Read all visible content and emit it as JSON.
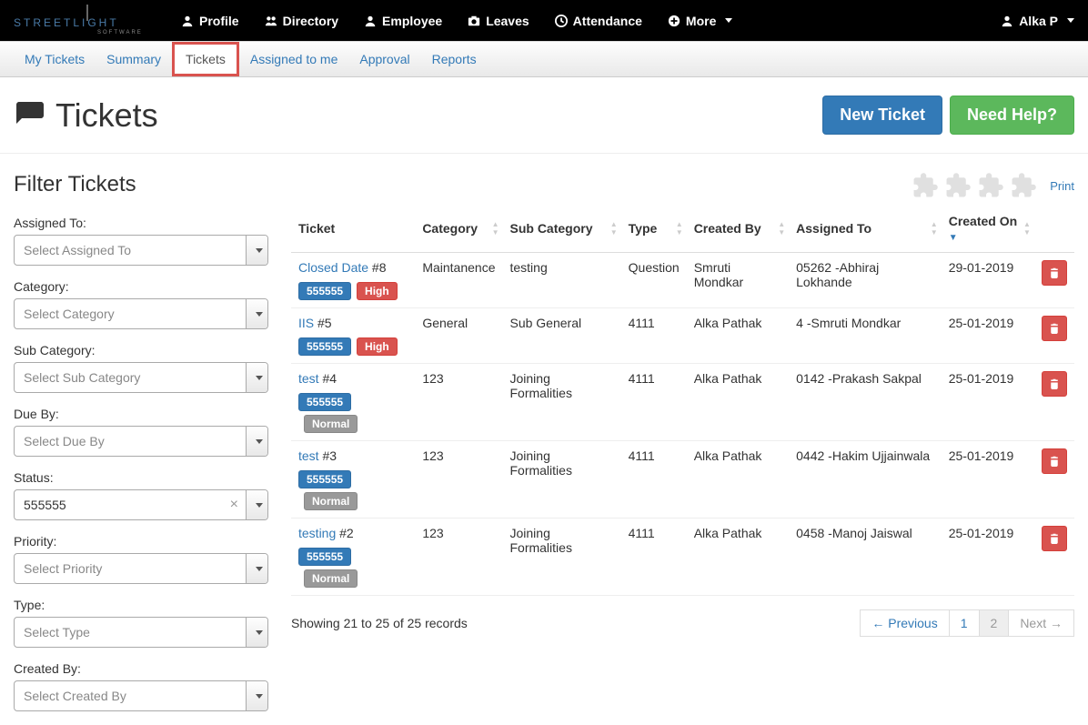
{
  "nav": {
    "logo_text": "STREETLIGHT SOFTWARE",
    "items": [
      {
        "label": "Profile"
      },
      {
        "label": "Directory"
      },
      {
        "label": "Employee"
      },
      {
        "label": "Leaves"
      },
      {
        "label": "Attendance"
      },
      {
        "label": "More"
      }
    ],
    "user": "Alka P"
  },
  "subnav": {
    "tabs": [
      "My Tickets",
      "Summary",
      "Tickets",
      "Assigned to me",
      "Approval",
      "Reports"
    ],
    "active_index": 2
  },
  "page": {
    "title": "Tickets",
    "new_ticket": "New Ticket",
    "need_help": "Need Help?"
  },
  "filters": {
    "title": "Filter Tickets",
    "groups": [
      {
        "label": "Assigned To:",
        "placeholder": "Select Assigned To",
        "value": ""
      },
      {
        "label": "Category:",
        "placeholder": "Select Category",
        "value": ""
      },
      {
        "label": "Sub Category:",
        "placeholder": "Select Sub Category",
        "value": ""
      },
      {
        "label": "Due By:",
        "placeholder": "Select Due By",
        "value": ""
      },
      {
        "label": "Status:",
        "placeholder": "",
        "value": "555555"
      },
      {
        "label": "Priority:",
        "placeholder": "Select Priority",
        "value": ""
      },
      {
        "label": "Type:",
        "placeholder": "Select Type",
        "value": ""
      },
      {
        "label": "Created By:",
        "placeholder": "Select Created By",
        "value": ""
      }
    ]
  },
  "toolbar": {
    "print": "Print"
  },
  "table": {
    "headers": [
      "Ticket",
      "Category",
      "Sub Category",
      "Type",
      "Created By",
      "Assigned To",
      "Created On",
      ""
    ],
    "rows": [
      {
        "title": "Closed Date",
        "num": "#8",
        "status": "555555",
        "priority": "High",
        "category": "Maintanence",
        "subcategory": "testing",
        "type": "Question",
        "created_by": "Smruti Mondkar",
        "assigned_to": "05262 -Abhiraj Lokhande",
        "created_on": "29-01-2019"
      },
      {
        "title": "IIS",
        "num": "#5",
        "status": "555555",
        "priority": "High",
        "category": "General",
        "subcategory": "Sub General",
        "type": "4111",
        "created_by": "Alka Pathak",
        "assigned_to": "4 -Smruti Mondkar",
        "created_on": "25-01-2019"
      },
      {
        "title": "test",
        "num": "#4",
        "status": "555555",
        "priority": "Normal",
        "category": "123",
        "subcategory": "Joining Formalities",
        "type": "4111",
        "created_by": "Alka Pathak",
        "assigned_to": "0142 -Prakash Sakpal",
        "created_on": "25-01-2019"
      },
      {
        "title": "test",
        "num": "#3",
        "status": "555555",
        "priority": "Normal",
        "category": "123",
        "subcategory": "Joining Formalities",
        "type": "4111",
        "created_by": "Alka Pathak",
        "assigned_to": "0442 -Hakim Ujjainwala",
        "created_on": "25-01-2019"
      },
      {
        "title": "testing",
        "num": "#2",
        "status": "555555",
        "priority": "Normal",
        "category": "123",
        "subcategory": "Joining Formalities",
        "type": "4111",
        "created_by": "Alka Pathak",
        "assigned_to": "0458 -Manoj Jaiswal",
        "created_on": "25-01-2019"
      }
    ],
    "summary": "Showing 21 to 25 of 25 records",
    "paging": {
      "prev": "← Previous",
      "pages": [
        "1",
        "2"
      ],
      "current": 2,
      "next": "Next →"
    }
  }
}
